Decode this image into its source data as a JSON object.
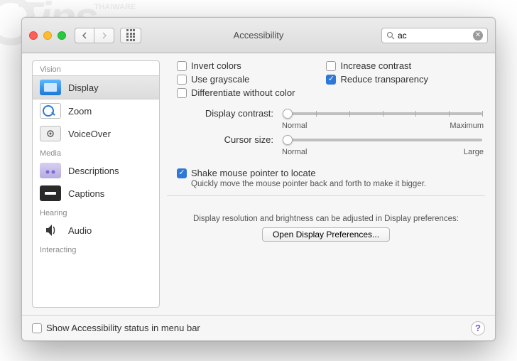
{
  "window": {
    "title": "Accessibility"
  },
  "search": {
    "value": "ac"
  },
  "sidebar": {
    "sections": [
      {
        "label": "Vision",
        "items": [
          {
            "label": "Display",
            "selected": true
          },
          {
            "label": "Zoom",
            "selected": false
          },
          {
            "label": "VoiceOver",
            "selected": false
          }
        ]
      },
      {
        "label": "Media",
        "items": [
          {
            "label": "Descriptions",
            "selected": false
          },
          {
            "label": "Captions",
            "selected": false
          }
        ]
      },
      {
        "label": "Hearing",
        "items": [
          {
            "label": "Audio",
            "selected": false
          }
        ]
      },
      {
        "label": "Interacting",
        "items": []
      }
    ]
  },
  "display": {
    "invert_colors": {
      "label": "Invert colors",
      "checked": false
    },
    "use_grayscale": {
      "label": "Use grayscale",
      "checked": false
    },
    "diff_without_color": {
      "label": "Differentiate without color",
      "checked": false
    },
    "increase_contrast": {
      "label": "Increase contrast",
      "checked": false
    },
    "reduce_transparency": {
      "label": "Reduce transparency",
      "checked": true
    },
    "contrast": {
      "label": "Display contrast:",
      "min_label": "Normal",
      "max_label": "Maximum",
      "value_pct": 2
    },
    "cursor": {
      "label": "Cursor size:",
      "min_label": "Normal",
      "max_label": "Large",
      "value_pct": 2
    },
    "shake": {
      "checked": true,
      "label": "Shake mouse pointer to locate",
      "hint": "Quickly move the mouse pointer back and forth to make it bigger."
    },
    "footer_note": "Display resolution and brightness can be adjusted in Display preferences:",
    "open_button": "Open Display Preferences..."
  },
  "bottom": {
    "show_status": {
      "label": "Show Accessibility status in menu bar",
      "checked": false
    }
  }
}
